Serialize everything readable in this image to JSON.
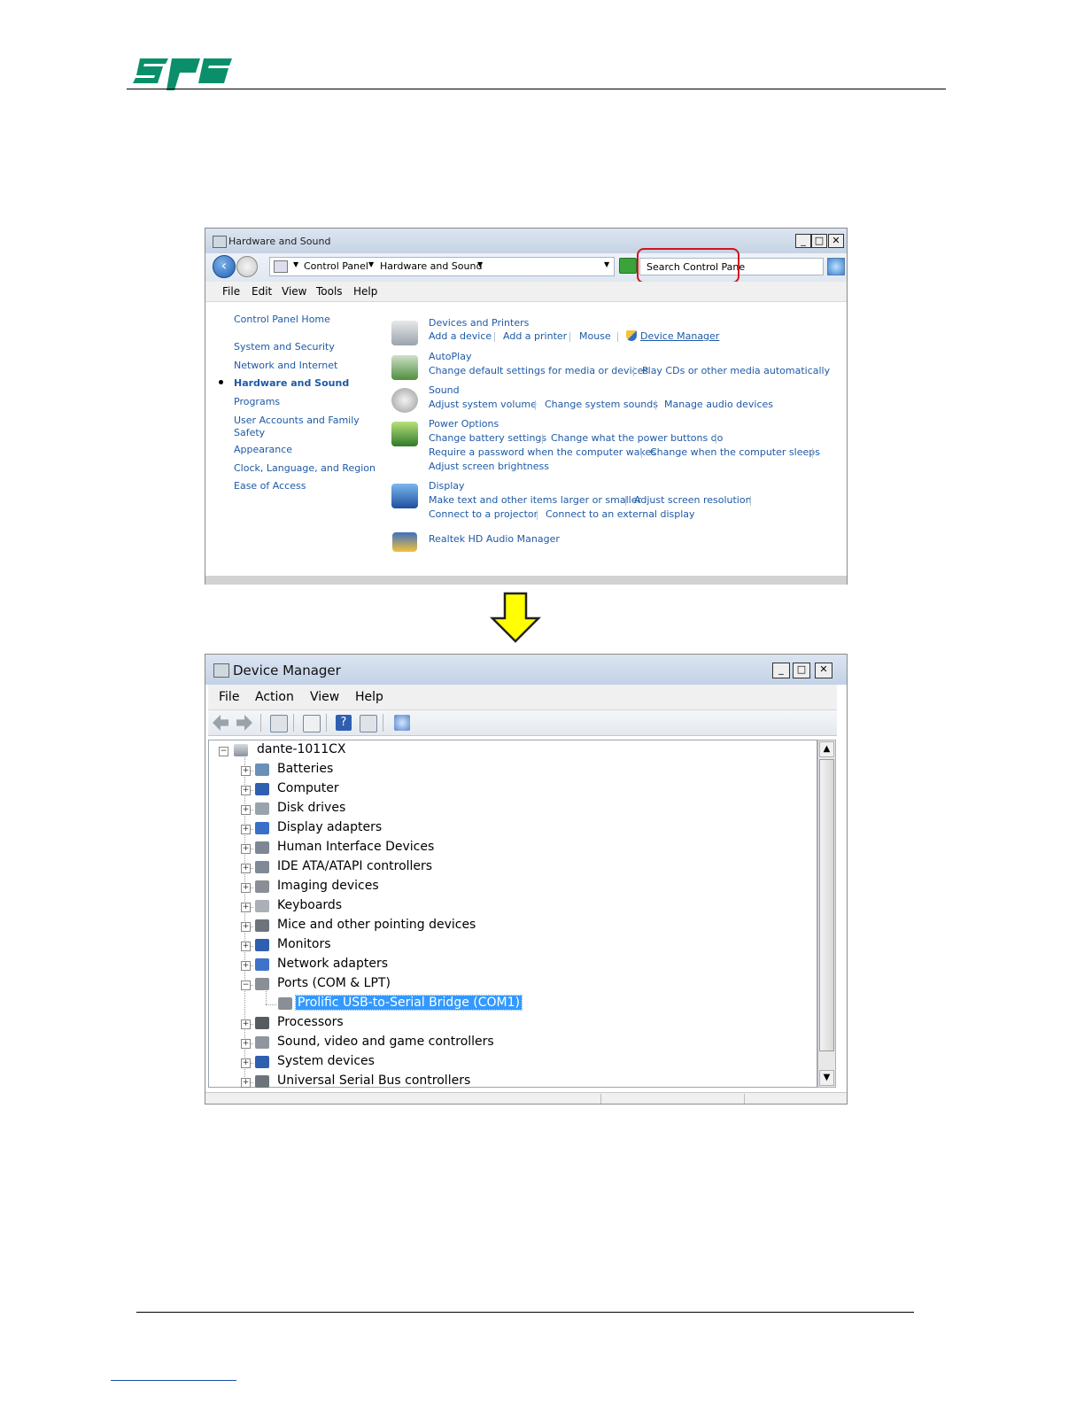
{
  "colors": {
    "logo": "#0b8f6a",
    "link": "#1e5aa6",
    "highlight_box": "#d0161b",
    "arrow_fill": "#ffff00",
    "selection": "#3399ff"
  },
  "window1": {
    "title": "Hardware and Sound",
    "breadcrumb": [
      "Control Panel",
      "Hardware and Sound"
    ],
    "search_placeholder": "Search Control Pane",
    "menu": [
      "File",
      "Edit",
      "View",
      "Tools",
      "Help"
    ],
    "sidebar": {
      "home": "Control Panel Home",
      "items": [
        "System and Security",
        "Network and Internet",
        "Hardware and Sound",
        "Programs",
        "User Accounts and Family",
        "Safety",
        "Appearance",
        "Clock, Language, and Region",
        "Ease of Access"
      ],
      "active": "Hardware and Sound"
    },
    "categories": [
      {
        "icon": "printer-icon",
        "title": "Devices and Printers",
        "lines": [
          [
            "Add a device",
            "Add a printer",
            "Mouse",
            "Device Manager"
          ]
        ]
      },
      {
        "icon": "autoplay-icon",
        "title": "AutoPlay",
        "lines": [
          [
            "Change default settings for media or devices",
            "Play CDs or other media automatically"
          ]
        ]
      },
      {
        "icon": "speaker-icon",
        "title": "Sound",
        "lines": [
          [
            "Adjust system volume",
            "Change system sounds",
            "Manage audio devices"
          ]
        ]
      },
      {
        "icon": "battery-icon",
        "title": "Power Options",
        "lines": [
          [
            "Change battery settings",
            "Change what the power buttons do"
          ],
          [
            "Require a password when the computer wakes",
            "Change when the computer sleeps"
          ],
          [
            "Adjust screen brightness"
          ]
        ]
      },
      {
        "icon": "display-icon",
        "title": "Display",
        "lines": [
          [
            "Make text and other items larger or smaller",
            "Adjust screen resolution"
          ],
          [
            "Connect to a projector",
            "Connect to an external display"
          ]
        ]
      },
      {
        "icon": "audio-manager-icon",
        "title": "Realtek HD Audio Manager",
        "lines": []
      }
    ]
  },
  "window2": {
    "title": "Device Manager",
    "menu": [
      "File",
      "Action",
      "View",
      "Help"
    ],
    "tree": {
      "root": "dante-1011CX",
      "items": [
        {
          "label": "Batteries",
          "icon": "battery-icon",
          "expanded": false
        },
        {
          "label": "Computer",
          "icon": "computer-icon",
          "expanded": false
        },
        {
          "label": "Disk drives",
          "icon": "disk-icon",
          "expanded": false
        },
        {
          "label": "Display adapters",
          "icon": "display-adapter-icon",
          "expanded": false
        },
        {
          "label": "Human Interface Devices",
          "icon": "hid-icon",
          "expanded": false
        },
        {
          "label": "IDE ATA/ATAPI controllers",
          "icon": "ide-icon",
          "expanded": false
        },
        {
          "label": "Imaging devices",
          "icon": "camera-icon",
          "expanded": false
        },
        {
          "label": "Keyboards",
          "icon": "keyboard-icon",
          "expanded": false
        },
        {
          "label": "Mice and other pointing devices",
          "icon": "mouse-icon",
          "expanded": false
        },
        {
          "label": "Monitors",
          "icon": "monitor-icon",
          "expanded": false
        },
        {
          "label": "Network adapters",
          "icon": "network-icon",
          "expanded": false
        },
        {
          "label": "Ports (COM & LPT)",
          "icon": "port-icon",
          "expanded": true
        },
        {
          "label": "Prolific USB-to-Serial Bridge (COM1)",
          "icon": "port-icon",
          "child": true,
          "selected": true
        },
        {
          "label": "Processors",
          "icon": "processor-icon",
          "expanded": false
        },
        {
          "label": "Sound, video and game controllers",
          "icon": "speaker-icon",
          "expanded": false
        },
        {
          "label": "System devices",
          "icon": "system-icon",
          "expanded": false
        },
        {
          "label": "Universal Serial Bus controllers",
          "icon": "usb-icon",
          "expanded": false
        }
      ]
    }
  }
}
